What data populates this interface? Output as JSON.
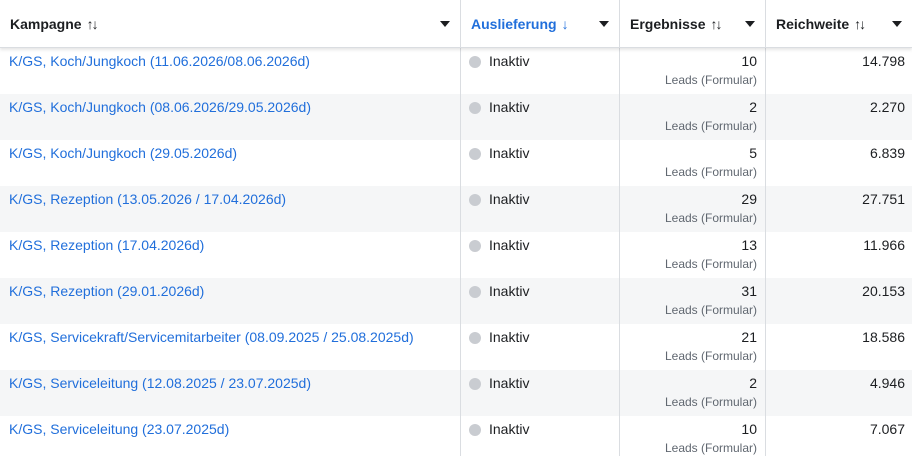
{
  "columns": {
    "campaign": {
      "label": "Kampagne",
      "sort_icon": "↑↓"
    },
    "delivery": {
      "label": "Auslieferung",
      "sort_icon": "↓"
    },
    "results": {
      "label": "Ergebnisse",
      "sort_icon": "↑↓"
    },
    "reach": {
      "label": "Reichweite",
      "sort_icon": "↑↓"
    }
  },
  "icons": {
    "sort": "sort-arrows-icon",
    "sort_desc": "arrow-down-icon",
    "dropdown": "caret-down-icon",
    "status": "status-dot-icon"
  },
  "colors": {
    "link": "#216fdb",
    "inactive_dot": "#c9ccd1",
    "row_alt": "#f5f6f7"
  },
  "rows": [
    {
      "campaign": "K/GS, Koch/Jungkoch (11.06.2026/08.06.2026d)",
      "status": "Inaktiv",
      "results": "10",
      "results_unit": "Leads (Formular)",
      "reach": "14.798"
    },
    {
      "campaign": "K/GS, Koch/Jungkoch (08.06.2026/29.05.2026d)",
      "status": "Inaktiv",
      "results": "2",
      "results_unit": "Leads (Formular)",
      "reach": "2.270"
    },
    {
      "campaign": "K/GS, Koch/Jungkoch (29.05.2026d)",
      "status": "Inaktiv",
      "results": "5",
      "results_unit": "Leads (Formular)",
      "reach": "6.839"
    },
    {
      "campaign": "K/GS, Rezeption (13.05.2026 / 17.04.2026d)",
      "status": "Inaktiv",
      "results": "29",
      "results_unit": "Leads (Formular)",
      "reach": "27.751"
    },
    {
      "campaign": "K/GS, Rezeption (17.04.2026d)",
      "status": "Inaktiv",
      "results": "13",
      "results_unit": "Leads (Formular)",
      "reach": "11.966"
    },
    {
      "campaign": "K/GS, Rezeption (29.01.2026d)",
      "status": "Inaktiv",
      "results": "31",
      "results_unit": "Leads (Formular)",
      "reach": "20.153"
    },
    {
      "campaign": "K/GS, Servicekraft/Servicemitarbeiter (08.09.2025 / 25.08.2025d)",
      "status": "Inaktiv",
      "results": "21",
      "results_unit": "Leads (Formular)",
      "reach": "18.586"
    },
    {
      "campaign": "K/GS, Serviceleitung (12.08.2025 / 23.07.2025d)",
      "status": "Inaktiv",
      "results": "2",
      "results_unit": "Leads (Formular)",
      "reach": "4.946"
    },
    {
      "campaign": "K/GS, Serviceleitung (23.07.2025d)",
      "status": "Inaktiv",
      "results": "10",
      "results_unit": "Leads (Formular)",
      "reach": "7.067"
    }
  ]
}
